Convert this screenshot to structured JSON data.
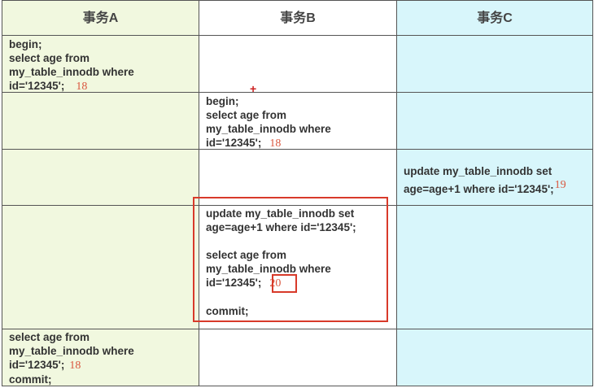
{
  "headers": [
    "事务A",
    "事务B",
    "事务C"
  ],
  "rows": [
    {
      "a": {
        "lines": [
          "begin;",
          "select age from",
          "my_table_innodb where",
          "id='12345';"
        ],
        "value": "18"
      }
    },
    {
      "b": {
        "lines": [
          "begin;",
          "select age from",
          "my_table_innodb where",
          "id='12345';"
        ],
        "value": "18"
      }
    },
    {
      "c": {
        "lines": [
          "update my_table_innodb set",
          "age=age+1 where id='12345';"
        ],
        "value": "19"
      }
    },
    {
      "b": {
        "lines": [
          "update my_table_innodb set",
          "age=age+1 where id='12345';",
          "",
          "select age from",
          "my_table_innodb where",
          "id='12345';",
          "",
          "commit;"
        ],
        "value": "20"
      }
    },
    {
      "a": {
        "lines": [
          "select age from",
          "my_table_innodb where",
          "id='12345';",
          "commit;"
        ],
        "value": "18"
      }
    }
  ]
}
